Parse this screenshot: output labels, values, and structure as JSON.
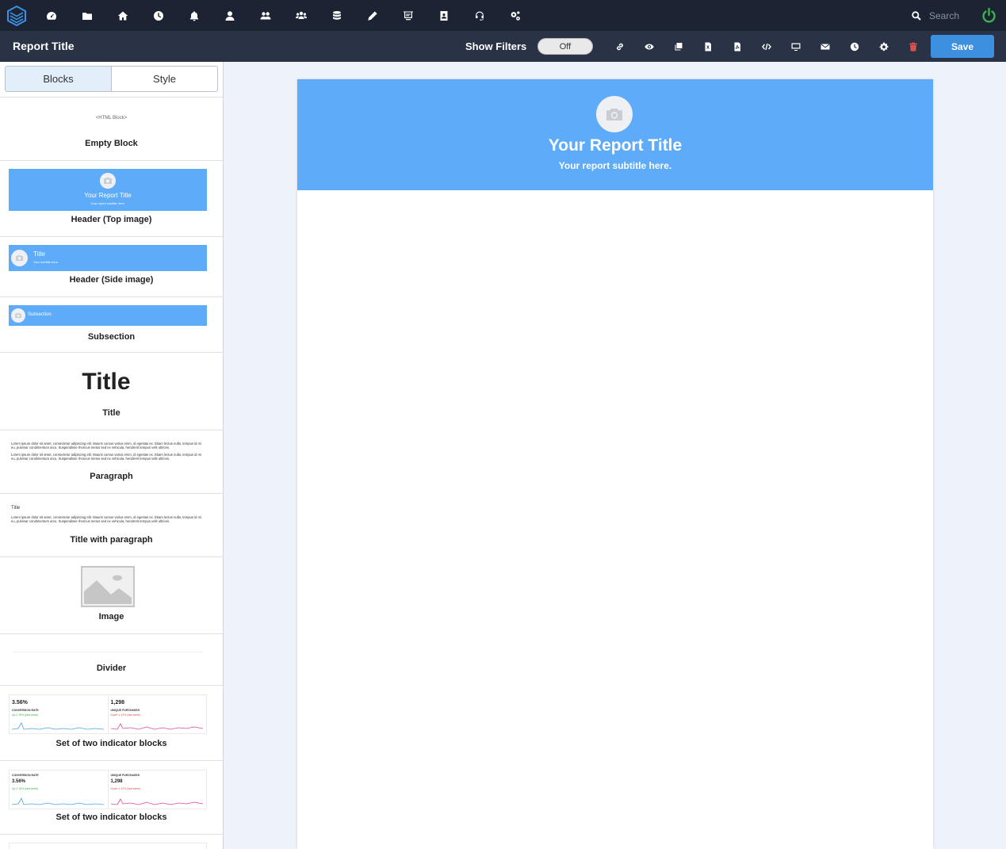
{
  "search": {
    "placeholder": "Search"
  },
  "nav_icons": [
    "dashboard-icon",
    "folder-icon",
    "home-icon",
    "clock-icon",
    "bell-icon",
    "user-icon",
    "users-icon",
    "team-icon",
    "database-icon",
    "pencil-icon",
    "presentation-icon",
    "address-book-icon",
    "headset-icon",
    "settings-cogs-icon"
  ],
  "toolbar": {
    "report_title": "Report Title",
    "show_filters_label": "Show Filters",
    "filters_toggle": "Off",
    "save_label": "Save"
  },
  "sidebar": {
    "tabs": [
      "Blocks",
      "Style"
    ],
    "active_tab": "Blocks",
    "blocks": {
      "empty": {
        "preview_text": "<HTML Block>",
        "label": "Empty Block"
      },
      "header_top": {
        "preview_title": "Your Report Title",
        "preview_subtitle": "Your report subtitle here.",
        "label": "Header (Top image)"
      },
      "header_side": {
        "preview_title": "Title",
        "preview_subtitle": "Your subtitle here.",
        "label": "Header (Side image)"
      },
      "subsection": {
        "preview_title": "Subsection",
        "label": "Subsection"
      },
      "title": {
        "preview_text": "Title",
        "label": "Title"
      },
      "paragraph": {
        "preview_text": "Lorem ipsum dolor sit amet, consectetur adipiscing elit. Mauris cursus varius enim, id egestas ex. Etiam lectus nulla, tempus id mi eu, pulvinar condimentum arcu. Suspendisse rhoncus metus sed ex vehicula, hendrerit tempus velit ultrices.",
        "preview_text_2": "Lorem ipsum dolor sit amet, consectetur adipiscing elit. Mauris cursus varius enim, id egestas ex. Etiam lectus nulla, tempus id mi eu, pulvinar condimentum arcu. Suspendisse rhoncus metus sed ex vehicula, hendrerit tempus velit ultrices.",
        "label": "Paragraph"
      },
      "title_paragraph": {
        "preview_title": "Title",
        "preview_text": "Lorem ipsum dolor sit amet, consectetur adipiscing elit. Mauris cursus varius enim, id egestas ex. Etiam lectus nulla, tempus id mi eu, pulvinar condimentum arcu. Suspendisse rhoncus metus sed ex vehicula, hendrerit tempus velit ultrices.",
        "label": "Title with paragraph"
      },
      "image": {
        "label": "Image"
      },
      "divider": {
        "label": "Divider"
      },
      "indicators_1": {
        "left": {
          "value": "3.56%",
          "name": "CONVERSION RATE",
          "delta": "Up 2.78% (last week)"
        },
        "right": {
          "value": "1,298",
          "name": "UNIQUE PURCHASES",
          "delta": "Down 1.12% (last week)"
        },
        "label": "Set of two indicator blocks"
      },
      "indicators_2": {
        "left": {
          "value": "3.56%",
          "name": "CONVERSION RATE",
          "delta": "Up 2.78% (last week)"
        },
        "right": {
          "value": "1,298",
          "name": "UNIQUE PURCHASES",
          "delta": "Down 1.12% (last week)"
        },
        "label": "Set of two indicator blocks"
      }
    }
  },
  "canvas": {
    "header_title": "Your Report Title",
    "header_subtitle": "Your report subtitle here."
  },
  "colors": {
    "nav_bg": "#1c2333",
    "toolbar_bg": "#2a3246",
    "accent_blue": "#5eabfa",
    "save_blue": "#3d8fe0",
    "power_green": "#3cb34a",
    "delete_red": "#d9534f",
    "sparkline_blue": "#4aa3df",
    "sparkline_pink": "#d94a9a"
  }
}
